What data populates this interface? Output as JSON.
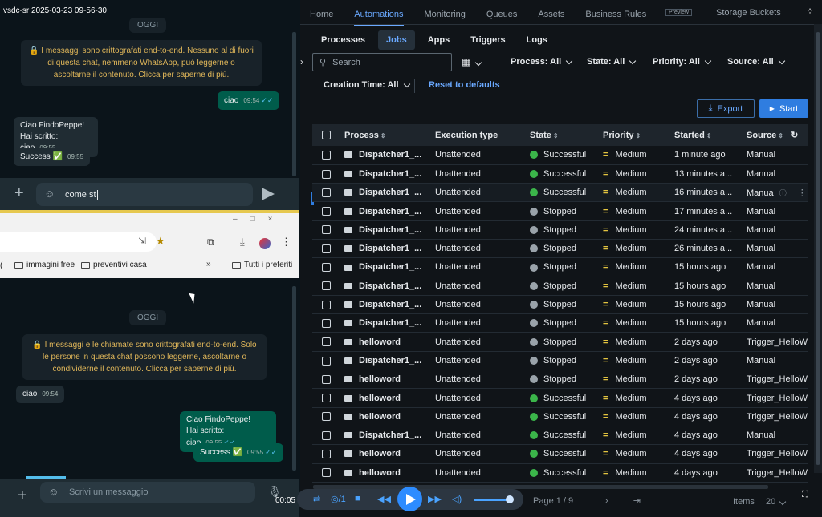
{
  "recording": {
    "label": "vsdc-sr 2025-03-23 09-56-30",
    "timecode": "00:05"
  },
  "whatsapp_top": {
    "day": "OGGI",
    "encryption": "🔒 I messaggi sono crittografati end-to-end. Nessuno al di fuori di questa chat, nemmeno WhatsApp, può leggerne o ascoltarne il contenuto. Clicca per saperne di più.",
    "messages": [
      {
        "text": "ciao",
        "time": "09:54",
        "dir": "out"
      },
      {
        "text": "Ciao FindoPeppe!\nHai scritto: ciao",
        "time": "09:55",
        "dir": "in"
      },
      {
        "text": "Success ✅",
        "time": "09:55",
        "dir": "in"
      }
    ],
    "input_value": "come st"
  },
  "chrome": {
    "bookmarks": [
      "immagini free",
      "preventivi casa",
      "Tutti i preferiti"
    ],
    "more": "»"
  },
  "whatsapp_bottom": {
    "day": "OGGI",
    "encryption": "🔒 I messaggi e le chiamate sono crittografati end-to-end. Solo le persone in questa chat possono leggerne, ascoltarne o condividerne il contenuto. Clicca per saperne di più.",
    "messages": [
      {
        "text": "ciao",
        "time": "09:54",
        "dir": "in"
      },
      {
        "text": "Ciao FindoPeppe!\nHai scritto: ciao",
        "time": "09:55",
        "dir": "out"
      },
      {
        "text": "Success ✅",
        "time": "09:55",
        "dir": "out"
      }
    ],
    "placeholder": "Scrivi un messaggio"
  },
  "orchestrator": {
    "topnav": [
      "Home",
      "Automations",
      "Monitoring",
      "Queues",
      "Assets",
      "Business Rules",
      "Storage Buckets"
    ],
    "preview_badge": "Preview",
    "subtabs": [
      "Processes",
      "Jobs",
      "Apps",
      "Triggers",
      "Logs"
    ],
    "active_subtab": "Jobs",
    "search_placeholder": "Search",
    "filters": [
      "Process: All",
      "State: All",
      "Priority: All",
      "Source: All"
    ],
    "creation_time": "Creation Time: All",
    "reset": "Reset to defaults",
    "export": "Export",
    "start": "Start",
    "columns": [
      "Process",
      "Execution type",
      "State",
      "Priority",
      "Started",
      "Source"
    ],
    "rows": [
      {
        "process": "Dispatcher1_...",
        "exec": "Unattended",
        "state": "Successful",
        "priority": "Medium",
        "started": "1 minute ago",
        "source": "Manual"
      },
      {
        "process": "Dispatcher1_...",
        "exec": "Unattended",
        "state": "Successful",
        "priority": "Medium",
        "started": "13 minutes a...",
        "source": "Manual"
      },
      {
        "process": "Dispatcher1_...",
        "exec": "Unattended",
        "state": "Successful",
        "priority": "Medium",
        "started": "16 minutes a...",
        "source": "Manua"
      },
      {
        "process": "Dispatcher1_...",
        "exec": "Unattended",
        "state": "Stopped",
        "priority": "Medium",
        "started": "17 minutes a...",
        "source": "Manual"
      },
      {
        "process": "Dispatcher1_...",
        "exec": "Unattended",
        "state": "Stopped",
        "priority": "Medium",
        "started": "24 minutes a...",
        "source": "Manual"
      },
      {
        "process": "Dispatcher1_...",
        "exec": "Unattended",
        "state": "Stopped",
        "priority": "Medium",
        "started": "26 minutes a...",
        "source": "Manual"
      },
      {
        "process": "Dispatcher1_...",
        "exec": "Unattended",
        "state": "Stopped",
        "priority": "Medium",
        "started": "15 hours ago",
        "source": "Manual"
      },
      {
        "process": "Dispatcher1_...",
        "exec": "Unattended",
        "state": "Stopped",
        "priority": "Medium",
        "started": "15 hours ago",
        "source": "Manual"
      },
      {
        "process": "Dispatcher1_...",
        "exec": "Unattended",
        "state": "Stopped",
        "priority": "Medium",
        "started": "15 hours ago",
        "source": "Manual"
      },
      {
        "process": "Dispatcher1_...",
        "exec": "Unattended",
        "state": "Stopped",
        "priority": "Medium",
        "started": "15 hours ago",
        "source": "Manual"
      },
      {
        "process": "helloword",
        "exec": "Unattended",
        "state": "Stopped",
        "priority": "Medium",
        "started": "2 days ago",
        "source": "Trigger_HelloWo"
      },
      {
        "process": "Dispatcher1_...",
        "exec": "Unattended",
        "state": "Stopped",
        "priority": "Medium",
        "started": "2 days ago",
        "source": "Manual"
      },
      {
        "process": "helloword",
        "exec": "Unattended",
        "state": "Stopped",
        "priority": "Medium",
        "started": "2 days ago",
        "source": "Trigger_HelloWo"
      },
      {
        "process": "helloword",
        "exec": "Unattended",
        "state": "Successful",
        "priority": "Medium",
        "started": "4 days ago",
        "source": "Trigger_HelloWo"
      },
      {
        "process": "helloword",
        "exec": "Unattended",
        "state": "Successful",
        "priority": "Medium",
        "started": "4 days ago",
        "source": "Trigger_HelloWo"
      },
      {
        "process": "Dispatcher1_...",
        "exec": "Unattended",
        "state": "Successful",
        "priority": "Medium",
        "started": "4 days ago",
        "source": "Manual"
      },
      {
        "process": "helloword",
        "exec": "Unattended",
        "state": "Successful",
        "priority": "Medium",
        "started": "4 days ago",
        "source": "Trigger_HelloWo"
      },
      {
        "process": "helloword",
        "exec": "Unattended",
        "state": "Successful",
        "priority": "Medium",
        "started": "4 days ago",
        "source": "Trigger_HelloWo"
      }
    ],
    "pager": {
      "page": "Page 1 / 9",
      "items_label": "Items",
      "items_value": "20"
    },
    "colors": {
      "accent": "#6aa9ff",
      "success": "#3bb54a",
      "stopped": "#9aa3aa",
      "priority": "#e3c440"
    }
  }
}
